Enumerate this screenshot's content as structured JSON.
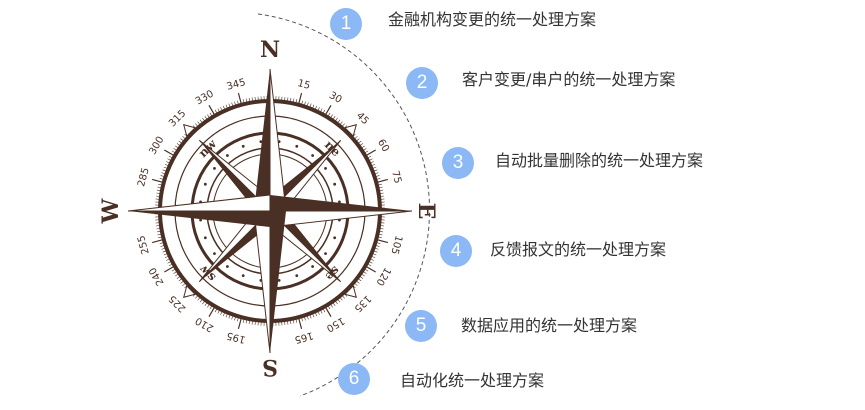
{
  "compass": {
    "cardinals": {
      "n": "N",
      "e": "E",
      "s": "S",
      "w": "W"
    },
    "intercardinals": {
      "ne": "ne",
      "se": "se",
      "sw": "sw",
      "nw": "nw"
    },
    "degree_labels": [
      "15",
      "30",
      "45",
      "60",
      "75",
      "105",
      "120",
      "135",
      "150",
      "165",
      "195",
      "210",
      "225",
      "240",
      "255",
      "285",
      "300",
      "315",
      "330",
      "345"
    ],
    "color": "#4a2f24"
  },
  "items": [
    {
      "number": "1",
      "label": "金融机构变更的统一处理方案"
    },
    {
      "number": "2",
      "label": "客户变更/串户的统一处理方案"
    },
    {
      "number": "3",
      "label": "自动批量删除的统一处理方案"
    },
    {
      "number": "4",
      "label": "反馈报文的统一处理方案"
    },
    {
      "number": "5",
      "label": "数据应用的统一处理方案"
    },
    {
      "number": "6",
      "label": "自动化统一处理方案"
    }
  ],
  "badge_color": "#8cb8f5"
}
